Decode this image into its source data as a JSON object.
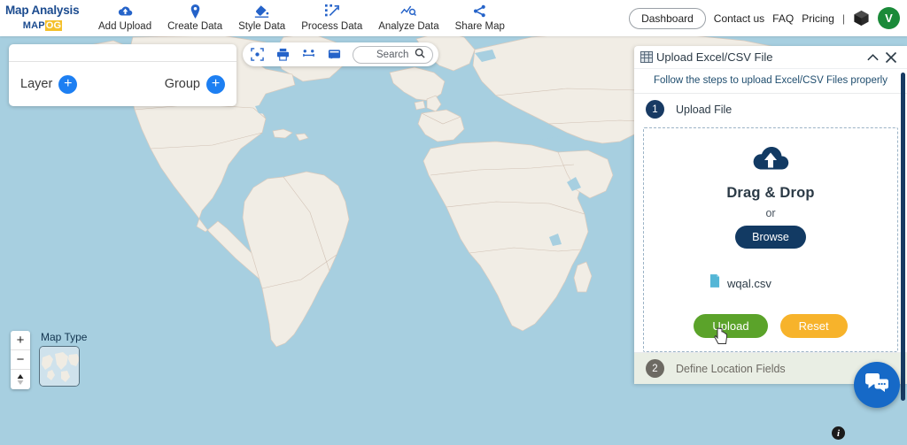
{
  "header": {
    "logo_title": "Map Analysis",
    "logo_map": "MAP",
    "logo_og": "OG",
    "nav": [
      {
        "label": "Add Upload",
        "icon": "cloud-upload-icon"
      },
      {
        "label": "Create Data",
        "icon": "map-pin-icon"
      },
      {
        "label": "Style Data",
        "icon": "paint-bucket-icon"
      },
      {
        "label": "Process Data",
        "icon": "transform-icon"
      },
      {
        "label": "Analyze Data",
        "icon": "analytics-icon"
      },
      {
        "label": "Share Map",
        "icon": "share-icon"
      }
    ],
    "dashboard_label": "Dashboard",
    "contact_label": "Contact us",
    "faq_label": "FAQ",
    "pricing_label": "Pricing",
    "separator": "|",
    "cube_icon": "cube-icon",
    "avatar_initial": "V",
    "avatar_color": "#1a8a39"
  },
  "layer_panel": {
    "layer_label": "Layer",
    "group_label": "Group",
    "add_symbol": "+"
  },
  "map_toolbar": {
    "icons": [
      {
        "name": "fullscreen-focus-icon"
      },
      {
        "name": "print-icon"
      },
      {
        "name": "measure-distance-icon"
      },
      {
        "name": "comment-icon"
      }
    ],
    "search_placeholder": "Search",
    "search_value": "",
    "search_icon": "search-icon"
  },
  "map_controls": {
    "zoom_in": "+",
    "zoom_out": "−",
    "compass": "▲",
    "map_type_label": "Map Type",
    "water_color": "#a7cfe0",
    "land_color": "#f1ede5",
    "border_color": "#d7c9bd"
  },
  "upload_panel": {
    "panel_icon": "spreadsheet-icon",
    "title": "Upload Excel/CSV File",
    "collapse_icon": "chevron-up-icon",
    "close_icon": "close-icon",
    "subtitle": "Follow the steps to upload Excel/CSV Files properly",
    "steps": [
      {
        "number": "1",
        "label": "Upload File",
        "state": "active"
      },
      {
        "number": "2",
        "label": "Define Location Fields",
        "state": "dim"
      }
    ],
    "dropzone": {
      "cloud_icon": "cloud-upload-icon",
      "title": "Drag & Drop",
      "or_label": "or",
      "browse_label": "Browse",
      "file_icon": "file-csv-icon",
      "file_name": "wqal.csv",
      "upload_label": "Upload",
      "reset_label": "Reset",
      "upload_color": "#5ba32a",
      "reset_color": "#f7b32b"
    }
  },
  "floating": {
    "chat_icon": "chat-bubbles-icon",
    "chat_color": "#1669c7",
    "info_label": "i"
  }
}
